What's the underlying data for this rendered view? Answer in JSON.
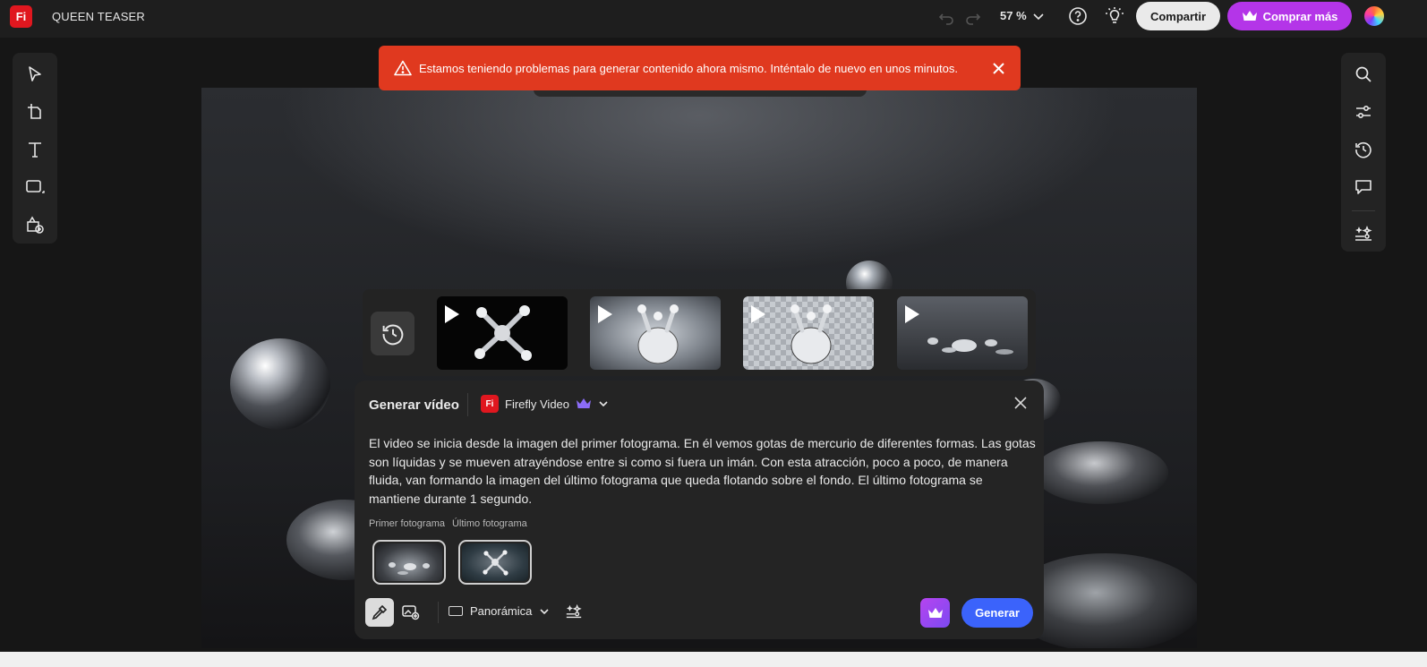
{
  "app": {
    "logo_text": "Fi",
    "document_title": "QUEEN TEASER"
  },
  "topbar": {
    "zoom_label": "57 %",
    "share_label": "Compartir",
    "buy_label": "Comprar más",
    "accent_buy": "#b435e8"
  },
  "toast": {
    "message": "Estamos teniendo problemas para generar contenido ahora mismo. Inténtalo de nuevo en unos minutos.",
    "color": "#e0391f"
  },
  "left_toolbar": {
    "tools": [
      "select-icon",
      "artboard-icon",
      "text-icon",
      "shape-icon",
      "generate-image-icon"
    ]
  },
  "right_toolbar": {
    "tools": [
      "search-icon",
      "adjust-icon",
      "history-icon",
      "comment-icon",
      "effects-icon"
    ]
  },
  "history": {
    "thumbnails": [
      "video-1",
      "video-2",
      "video-3",
      "video-4"
    ]
  },
  "panel": {
    "title": "Generar vídeo",
    "model_logo": "Fi",
    "model_name": "Firefly Video",
    "prompt": "El video se inicia desde la imagen del primer fotograma. En él vemos gotas de mercurio de diferentes formas. Las gotas son líquidas y se mueven atrayéndose entre si como si fuera un imán. Con esta atracción, poco a poco, de manera fluida, van formando la imagen del último fotograma que queda flotando sobre el fondo. El último fotograma se mantiene durante 1 segundo.",
    "first_frame_label": "Primer fotograma",
    "last_frame_label": "Último fotograma",
    "aspect_label": "Panorámica",
    "generate_label": "Generar",
    "accent_generate": "#3b63fb"
  }
}
